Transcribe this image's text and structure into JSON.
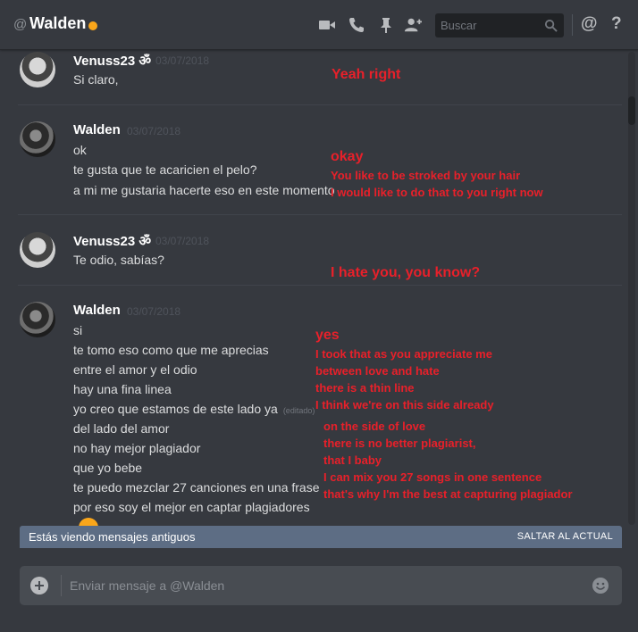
{
  "header": {
    "at_symbol": "@",
    "channel_name": "Walden",
    "status_color": "#faa61a",
    "search_placeholder": "Buscar",
    "icons": [
      "video-call-icon",
      "phone-call-icon",
      "pin-icon",
      "add-friend-icon",
      "search-icon",
      "mention-icon",
      "help-icon"
    ],
    "mention_glyph": "@",
    "help_glyph": "?"
  },
  "messages": [
    {
      "author": "Venuss23 ॐ",
      "timestamp": "03/07/2018",
      "lines": [
        "Si claro,"
      ],
      "translations": [
        "Yeah right"
      ]
    },
    {
      "author": "Walden",
      "timestamp": "03/07/2018",
      "lines": [
        "ok",
        "te gusta que te acaricien el pelo?",
        "a mi me gustaria hacerte eso en este momento"
      ],
      "translations": [
        "okay",
        "You like to be stroked by your hair",
        "I would like to do that to you right now"
      ]
    },
    {
      "author": "Venuss23 ॐ",
      "timestamp": "03/07/2018",
      "lines": [
        "Te odio, sabías?"
      ],
      "translations": [
        "I hate you, you know?"
      ]
    },
    {
      "author": "Walden",
      "timestamp": "03/07/2018",
      "lines": [
        "si",
        "te tomo eso como que me aprecias",
        "entre el amor y el odio",
        "hay una fina linea",
        "yo creo que estamos de este lado ya",
        "del lado del amor",
        "no hay mejor plagiador",
        "que yo bebe",
        "te puedo mezclar 27 canciones en una frase",
        "por eso soy el mejor en captar plagiadores"
      ],
      "edited_label": "(editado)",
      "translations": [
        "yes",
        "I took that as you appreciate me",
        "between love and hate",
        "there is a thin line",
        "I think we're on this side already",
        "on the side of love",
        "there is no better plagiarist,",
        "that I baby",
        "I can mix you 27 songs in one sentence",
        "that's why I'm the best at capturing plagiador"
      ]
    }
  ],
  "old_messages_bar": {
    "text": "Estás viendo mensajes antiguos",
    "jump_label": "SALTAR AL ACTUAL"
  },
  "composer": {
    "placeholder": "Enviar mensaje a @Walden"
  },
  "colors": {
    "background": "#36393f",
    "translation_text": "#e8202a",
    "old_bar": "#5d6d84"
  }
}
